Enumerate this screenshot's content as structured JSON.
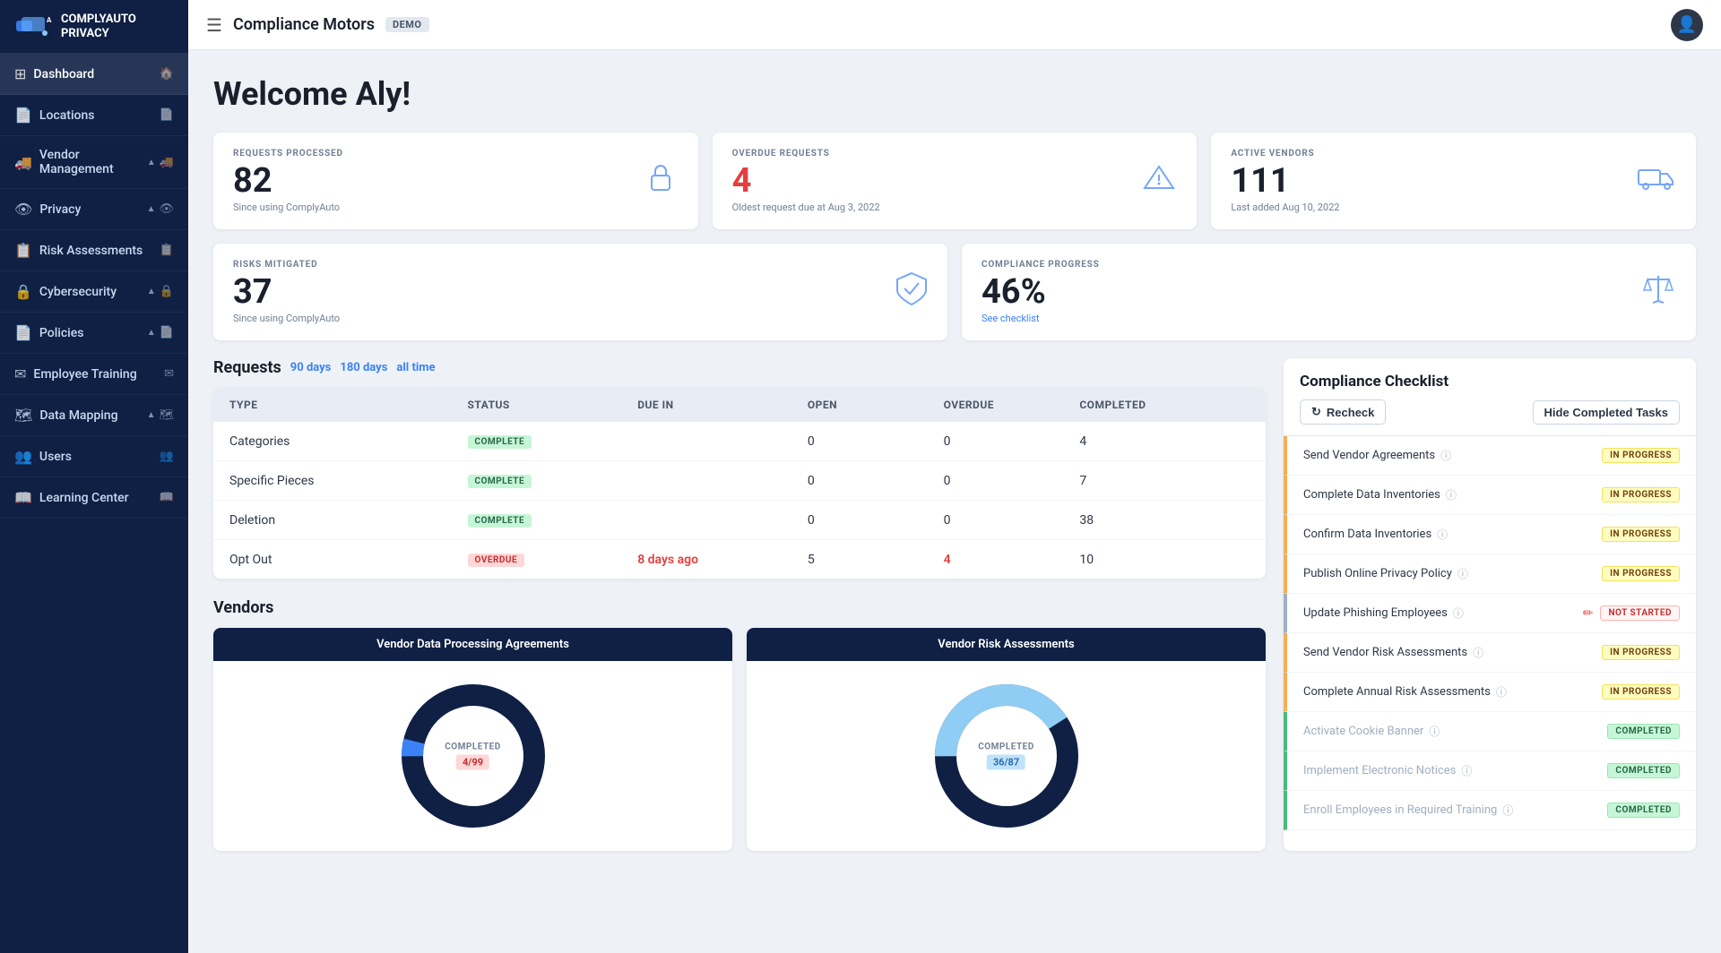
{
  "app": {
    "logo_line1": "COMPLYAUTO",
    "logo_line2": "PRIVACY"
  },
  "topbar": {
    "title": "Compliance Motors",
    "demo_badge": "DEMO",
    "toggle_label": "☰"
  },
  "sidebar": {
    "items": [
      {
        "id": "dashboard",
        "label": "Dashboard",
        "icon": "⊞",
        "active": true
      },
      {
        "id": "locations",
        "label": "Locations",
        "icon": "📄"
      },
      {
        "id": "vendor-management",
        "label": "Vendor Management",
        "icon": "🚚",
        "has_expand": true
      },
      {
        "id": "privacy",
        "label": "Privacy",
        "icon": "👁",
        "has_expand": true
      },
      {
        "id": "risk-assessments",
        "label": "Risk Assessments",
        "icon": "📋"
      },
      {
        "id": "cybersecurity",
        "label": "Cybersecurity",
        "icon": "🔒",
        "has_expand": true
      },
      {
        "id": "policies",
        "label": "Policies",
        "icon": "📄",
        "has_expand": true
      },
      {
        "id": "employee-training",
        "label": "Employee Training",
        "icon": "✉"
      },
      {
        "id": "data-mapping",
        "label": "Data Mapping",
        "icon": "🗺",
        "has_expand": true
      },
      {
        "id": "users",
        "label": "Users",
        "icon": "👥"
      },
      {
        "id": "learning-center",
        "label": "Learning Center",
        "icon": "📖"
      }
    ]
  },
  "stats": {
    "requests_processed": {
      "label": "REQUESTS PROCESSED",
      "value": "82",
      "sub": "Since using ComplyAuto",
      "icon": "🔒"
    },
    "overdue_requests": {
      "label": "OVERDUE REQUESTS",
      "value": "4",
      "sub": "Oldest request due at Aug 3, 2022",
      "icon": "⚠"
    },
    "active_vendors": {
      "label": "ACTIVE VENDORS",
      "value": "111",
      "sub": "Last added Aug 10, 2022",
      "icon": "🚚"
    },
    "risks_mitigated": {
      "label": "RISKS MITIGATED",
      "value": "37",
      "sub": "Since using ComplyAuto",
      "icon": "🛡"
    },
    "compliance_progress": {
      "label": "COMPLIANCE PROGRESS",
      "value": "46%",
      "sub": "See checklist",
      "icon": "⚖"
    }
  },
  "requests": {
    "section_title": "Requests",
    "links": [
      "90 days",
      "180 days",
      "all time"
    ],
    "columns": [
      "Type",
      "Status",
      "Due In",
      "Open",
      "Overdue",
      "Completed"
    ],
    "rows": [
      {
        "type": "Categories",
        "status": "COMPLETE",
        "status_type": "complete",
        "due_in": "",
        "open": "0",
        "overdue": "0",
        "completed": "4"
      },
      {
        "type": "Specific Pieces",
        "status": "COMPLETE",
        "status_type": "complete",
        "due_in": "",
        "open": "0",
        "overdue": "0",
        "completed": "7"
      },
      {
        "type": "Deletion",
        "status": "COMPLETE",
        "status_type": "complete",
        "due_in": "",
        "open": "0",
        "overdue": "0",
        "completed": "38"
      },
      {
        "type": "Opt Out",
        "status": "OVERDUE",
        "status_type": "overdue",
        "due_in": "8 days ago",
        "open": "5",
        "overdue": "4",
        "completed": "10"
      }
    ]
  },
  "vendors": {
    "section_title": "Vendors",
    "charts": [
      {
        "title": "Vendor Data Processing Agreements",
        "label": "COMPLETED",
        "value_badge": "4/99",
        "badge_type": "red",
        "completed_pct": 4,
        "total": 99
      },
      {
        "title": "Vendor Risk Assessments",
        "label": "COMPLETED",
        "value_badge": "36/87",
        "badge_type": "blue",
        "completed_pct": 41,
        "total": 87
      }
    ]
  },
  "checklist": {
    "title": "Compliance Checklist",
    "recheck_label": "Recheck",
    "hide_completed_label": "Hide Completed Tasks",
    "items": [
      {
        "name": "Send Vendor Agreements",
        "status": "IN PROGRESS",
        "status_type": "in-progress",
        "border": "yellow",
        "muted": false
      },
      {
        "name": "Complete Data Inventories",
        "status": "IN PROGRESS",
        "status_type": "in-progress",
        "border": "yellow",
        "muted": false
      },
      {
        "name": "Confirm Data Inventories",
        "status": "IN PROGRESS",
        "status_type": "in-progress",
        "border": "yellow",
        "muted": false
      },
      {
        "name": "Publish Online Privacy Policy",
        "status": "IN PROGRESS",
        "status_type": "in-progress",
        "border": "yellow",
        "muted": false
      },
      {
        "name": "Update Phishing Employees",
        "status": "NOT STARTED",
        "status_type": "not-started",
        "border": "gray",
        "muted": false,
        "has_pencil": true
      },
      {
        "name": "Send Vendor Risk Assessments",
        "status": "IN PROGRESS",
        "status_type": "in-progress",
        "border": "yellow",
        "muted": false
      },
      {
        "name": "Complete Annual Risk Assessments",
        "status": "IN PROGRESS",
        "status_type": "in-progress",
        "border": "yellow",
        "muted": false
      },
      {
        "name": "Activate Cookie Banner",
        "status": "COMPLETED",
        "status_type": "completed",
        "border": "green",
        "muted": true
      },
      {
        "name": "Implement Electronic Notices",
        "status": "COMPLETED",
        "status_type": "completed",
        "border": "green",
        "muted": true
      },
      {
        "name": "Enroll Employees in Required Training",
        "status": "COMPLETED",
        "status_type": "completed",
        "border": "green",
        "muted": true
      }
    ]
  },
  "welcome": {
    "title": "Welcome Aly!"
  }
}
